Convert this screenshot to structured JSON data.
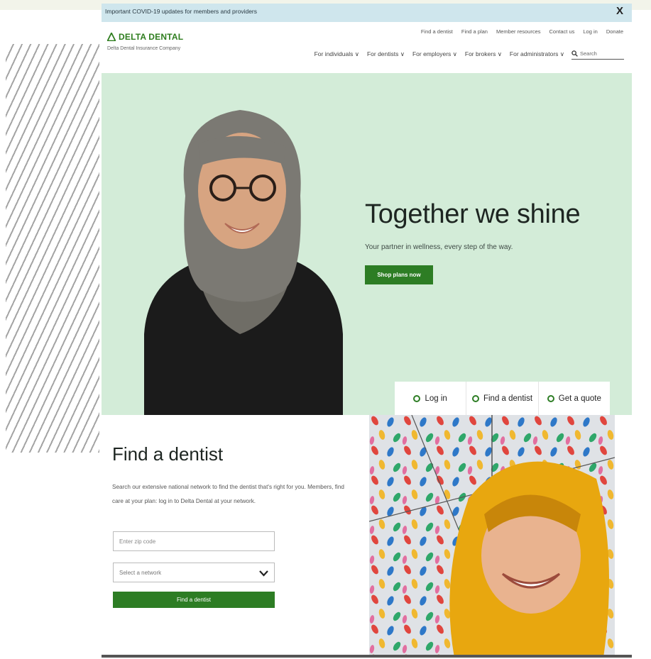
{
  "alert": {
    "text": "Important COVID-19 updates for members and providers",
    "close_label": "X"
  },
  "header": {
    "logo_text": "DELTA DENTAL",
    "tagline": "Delta Dental Insurance Company",
    "util_nav": [
      "Find a dentist",
      "Find a plan",
      "Member resources",
      "Contact us",
      "Log in",
      "Donate"
    ],
    "main_nav": [
      "For individuals ∨",
      "For dentists ∨",
      "For employers ∨",
      "For brokers ∨",
      "For administrators ∨"
    ],
    "search_placeholder": "Search"
  },
  "hero": {
    "title": "Together we shine",
    "subtitle": "Your partner in wellness, every step of the way.",
    "cta": "Shop plans now"
  },
  "quick_links": [
    "Log in",
    "Find a dentist",
    "Get a quote"
  ],
  "find": {
    "title": "Find a dentist",
    "description": "Search our extensive national network to find the dentist that's right for you. Members, find care at your plan: log in to Delta Dental at your network.",
    "zip_placeholder": "Enter zip code",
    "network_placeholder": "Select a network",
    "button": "Find a dentist"
  },
  "colors": {
    "brand_green": "#2d7d24",
    "hero_bg": "#d3ecd8",
    "alert_bg": "#cfe6ed"
  }
}
